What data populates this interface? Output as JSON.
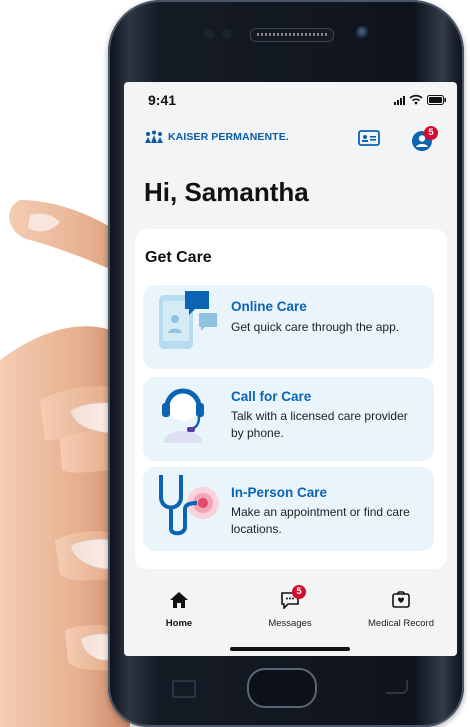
{
  "status_bar": {
    "time": "9:41"
  },
  "header": {
    "brand": "KAISER PERMANENTE.",
    "profile_badge": "5"
  },
  "greeting": "Hi, Samantha",
  "get_care": {
    "title": "Get Care",
    "items": [
      {
        "title": "Online Care",
        "description": "Get quick care through the app.",
        "icon": "chat-icon"
      },
      {
        "title": "Call for Care",
        "description": "Talk with a licensed care provider by phone.",
        "icon": "headset-icon"
      },
      {
        "title": "In-Person Care",
        "description": "Make an appointment or find care locations.",
        "icon": "stethoscope-icon"
      }
    ]
  },
  "tabs": [
    {
      "label": "Home",
      "icon": "home-icon",
      "active": true
    },
    {
      "label": "Messages",
      "icon": "message-icon",
      "badge": "5"
    },
    {
      "label": "Medical Record",
      "icon": "medical-record-icon"
    }
  ],
  "colors": {
    "brand_blue": "#0b63b3",
    "badge_red": "#d50b2c",
    "card_bg": "#eaf5fb"
  }
}
